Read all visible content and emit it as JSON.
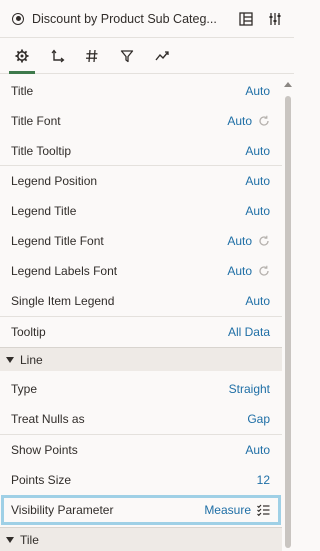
{
  "header": {
    "title": "Discount by Product Sub Categ...",
    "grammar_icon": "grammar-panel-icon",
    "properties_icon": "properties-panel-icon"
  },
  "tabs": [
    {
      "name": "general",
      "icon": "gear-icon",
      "active": true
    },
    {
      "name": "axis",
      "icon": "axis-icon",
      "active": false
    },
    {
      "name": "values",
      "icon": "hash-icon",
      "active": false
    },
    {
      "name": "filters",
      "icon": "filter-icon",
      "active": false
    },
    {
      "name": "analytics",
      "icon": "analytics-icon",
      "active": false
    }
  ],
  "rows": [
    {
      "label": "Title",
      "value": "Auto",
      "reset": false
    },
    {
      "label": "Title Font",
      "value": "Auto",
      "reset": true
    },
    {
      "label": "Title Tooltip",
      "value": "Auto",
      "reset": false
    },
    {
      "label": "Legend Position",
      "value": "Auto",
      "reset": false
    },
    {
      "label": "Legend Title",
      "value": "Auto",
      "reset": false
    },
    {
      "label": "Legend Title Font",
      "value": "Auto",
      "reset": true
    },
    {
      "label": "Legend Labels Font",
      "value": "Auto",
      "reset": true
    },
    {
      "label": "Single Item Legend",
      "value": "Auto",
      "reset": false
    },
    {
      "label": "Tooltip",
      "value": "All Data",
      "reset": false
    }
  ],
  "section_line": {
    "label": "Line"
  },
  "line_rows": [
    {
      "label": "Type",
      "value": "Straight"
    },
    {
      "label": "Treat Nulls as",
      "value": "Gap"
    },
    {
      "label": "Show Points",
      "value": "Auto"
    },
    {
      "label": "Points Size",
      "value": "12"
    }
  ],
  "visibility": {
    "label": "Visibility Parameter",
    "value": "Measure",
    "icon": "parameter-list-icon"
  },
  "section_tile": {
    "label": "Tile"
  },
  "colors": {
    "accent": "#3e7a4c",
    "link": "#1f6fa6",
    "highlight": "#9fd0e6"
  }
}
